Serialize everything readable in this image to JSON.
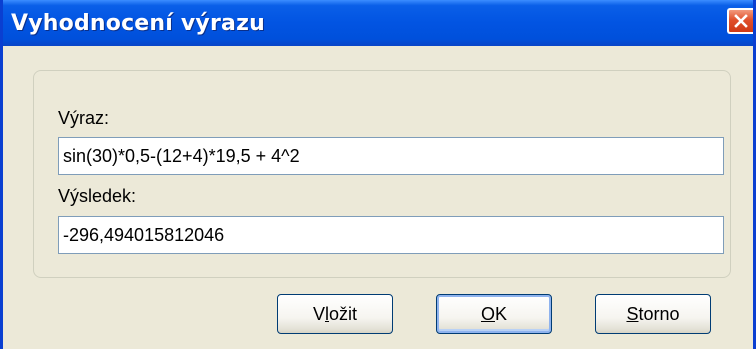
{
  "window": {
    "title": "Vyhodnocení výrazu"
  },
  "form": {
    "expression_label": "Výraz:",
    "expression_value": "sin(30)*0,5-(12+4)*19,5 + 4^2",
    "result_label": "Výsledek:",
    "result_value": "-296,494015812046"
  },
  "buttons": {
    "insert": {
      "before": "V",
      "mnemonic": "l",
      "after": "ožit"
    },
    "ok": {
      "before": "",
      "mnemonic": "O",
      "after": "K"
    },
    "cancel": {
      "before": "",
      "mnemonic": "S",
      "after": "torno"
    }
  },
  "icons": {
    "close": "close-x-icon"
  },
  "colors": {
    "titlebar": "#0254e2",
    "close_button": "#e0502c",
    "dialog_background": "#ece9d8",
    "field_border": "#7f9db9",
    "button_border": "#003c74"
  }
}
